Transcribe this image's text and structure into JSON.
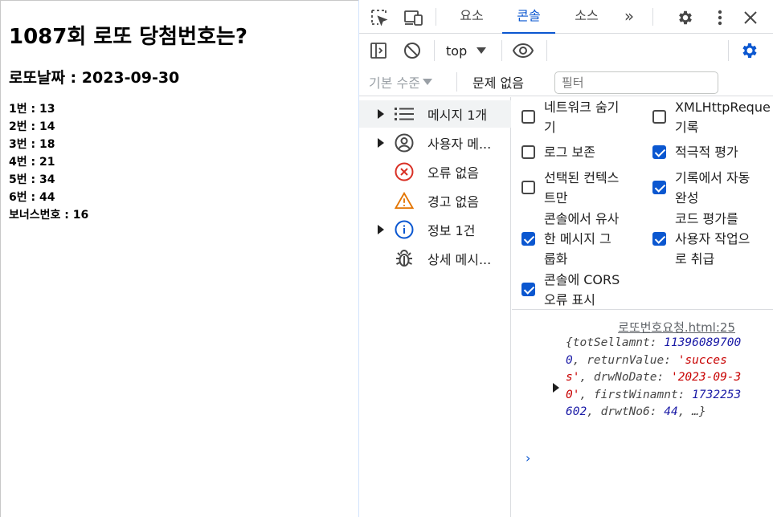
{
  "page": {
    "title": "1087회 로또 당첨번호는?",
    "date_line": "로또날짜 : 2023-09-30",
    "numbers": [
      "1번 : 13",
      "2번 : 14",
      "3번 : 18",
      "4번 : 21",
      "5번 : 34",
      "6번 : 44"
    ],
    "bonus": "보너스번호 : 16"
  },
  "devtools": {
    "tabs": [
      {
        "label": "요소",
        "active": false
      },
      {
        "label": "콘솔",
        "active": true
      },
      {
        "label": "소스",
        "active": false
      }
    ],
    "more_tabs": "»",
    "context": "top",
    "filter_placeholder": "필터",
    "levels": "기본 수준",
    "issues": "문제 없음",
    "accent": "#0b57d0",
    "sidebar": [
      {
        "label": "메시지 1개",
        "icon": "list-icon",
        "expandable": true,
        "selected": true
      },
      {
        "label": "사용자 메...",
        "icon": "user-icon",
        "expandable": true,
        "selected": false
      },
      {
        "label": "오류 없음",
        "icon": "error-icon",
        "expandable": false,
        "selected": false
      },
      {
        "label": "경고 없음",
        "icon": "warning-icon",
        "expandable": false,
        "selected": false
      },
      {
        "label": "정보 1건",
        "icon": "info-icon",
        "expandable": true,
        "selected": false
      },
      {
        "label": "상세 메시...",
        "icon": "bug-icon",
        "expandable": false,
        "selected": false
      }
    ],
    "settings": {
      "left": [
        {
          "lines": [
            "네트워크 숨기",
            "기"
          ],
          "checked": false
        },
        {
          "lines": [
            "로그 보존"
          ],
          "checked": false
        },
        {
          "lines": [
            "선택된 컨텍스",
            "트만"
          ],
          "checked": false
        },
        {
          "lines": [
            "콘솔에서 유사",
            "한 메시지 그",
            "룹화"
          ],
          "checked": true
        },
        {
          "lines": [
            "콘솔에 CORS",
            "오류 표시"
          ],
          "checked": true
        }
      ],
      "right": [
        {
          "lines": [
            "XMLHttpReque",
            "기록"
          ],
          "checked": false
        },
        {
          "lines": [
            "적극적 평가"
          ],
          "checked": true
        },
        {
          "lines": [
            "기록에서 자동",
            "완성"
          ],
          "checked": true
        },
        {
          "lines": [
            "코드 평가를",
            "사용자 작업으",
            "로 취급"
          ],
          "checked": true
        }
      ]
    },
    "console": {
      "source_link": "로또번호요청.html:25",
      "object_preview": [
        {
          "t": "k",
          "v": "{totSellamnt: "
        },
        {
          "t": "n",
          "v": "113960897000"
        },
        {
          "t": "k",
          "v": ", returnValue: "
        },
        {
          "t": "s",
          "v": "'success'"
        },
        {
          "t": "k",
          "v": ", drwNoDate: "
        },
        {
          "t": "s",
          "v": "'2023-09-30'"
        },
        {
          "t": "k",
          "v": ", firstWinamnt: "
        },
        {
          "t": "n",
          "v": "1732253602"
        },
        {
          "t": "k",
          "v": ", drwtNo6: "
        },
        {
          "t": "n",
          "v": "44"
        },
        {
          "t": "k",
          "v": ", …}"
        }
      ],
      "prompt": "›"
    }
  }
}
